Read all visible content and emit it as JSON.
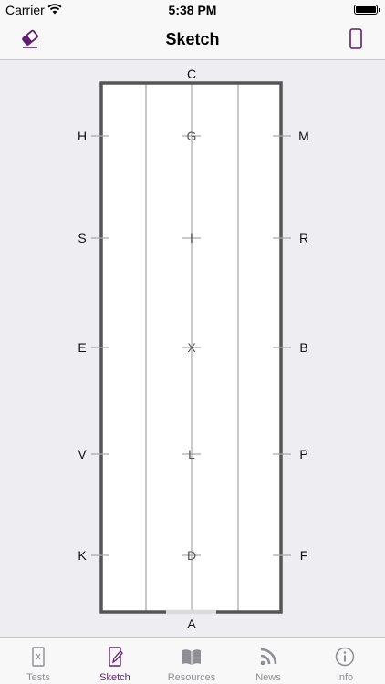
{
  "status_bar": {
    "carrier": "Carrier",
    "time": "5:38 PM"
  },
  "nav": {
    "title": "Sketch",
    "left_icon": "eraser-icon",
    "right_icon": "phone-outline-icon"
  },
  "arena": {
    "top_letter": "C",
    "bottom_letter": "A",
    "left_letters": [
      "H",
      "S",
      "E",
      "V",
      "K"
    ],
    "center_letters": [
      "G",
      "I",
      "X",
      "L",
      "D"
    ],
    "right_letters": [
      "M",
      "R",
      "B",
      "P",
      "F"
    ]
  },
  "tabs": [
    {
      "label": "Tests",
      "icon": "test-sheet-icon",
      "active": false
    },
    {
      "label": "Sketch",
      "icon": "sketch-pencil-icon",
      "active": true
    },
    {
      "label": "Resources",
      "icon": "book-icon",
      "active": false
    },
    {
      "label": "News",
      "icon": "rss-icon",
      "active": false
    },
    {
      "label": "Info",
      "icon": "info-icon",
      "active": false
    }
  ],
  "colors": {
    "accent": "#5f1f6e",
    "inactive": "#8e8e93",
    "arena_border": "#555555",
    "background": "#ededf2"
  }
}
